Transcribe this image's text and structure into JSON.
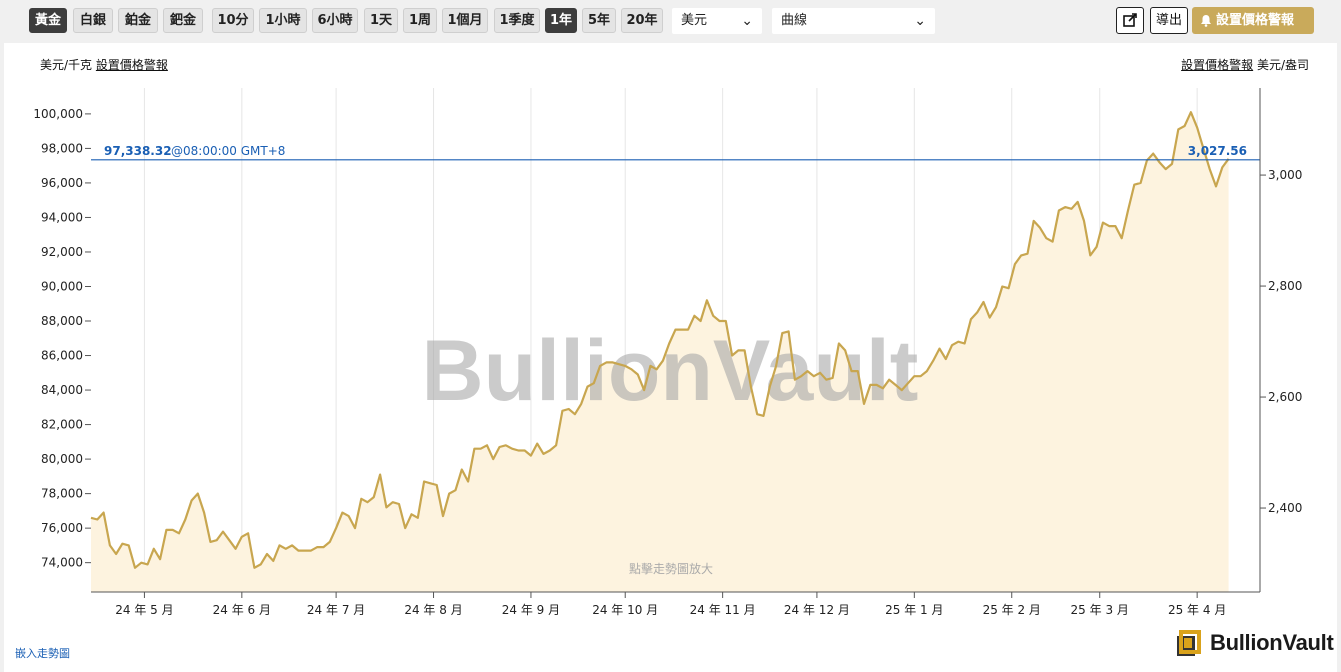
{
  "toolbar": {
    "metals": [
      {
        "label": "黃金",
        "active": true
      },
      {
        "label": "白銀",
        "active": false
      },
      {
        "label": "鉑金",
        "active": false
      },
      {
        "label": "鈀金",
        "active": false
      }
    ],
    "ranges": [
      {
        "label": "10分",
        "active": false
      },
      {
        "label": "1小時",
        "active": false
      },
      {
        "label": "6小時",
        "active": false
      },
      {
        "label": "1天",
        "active": false
      },
      {
        "label": "1周",
        "active": false
      },
      {
        "label": "1個月",
        "active": false
      },
      {
        "label": "1季度",
        "active": false
      },
      {
        "label": "1年",
        "active": true
      },
      {
        "label": "5年",
        "active": false
      },
      {
        "label": "20年",
        "active": false
      }
    ],
    "currency": "美元",
    "chart_style": "曲線",
    "export_label": "導出",
    "alert_label": "設置價格警報",
    "open_icon": "external-link-icon",
    "bell_icon": "bell-icon"
  },
  "unit_left": "美元/千克",
  "unit_right": "美元/盎司",
  "alert_link": "設置價格警報",
  "watermark": "BullionVault",
  "zoom_hint": "點擊走勢圖放大",
  "embed_link": "嵌入走勢圖",
  "logo_text": "BullionVault",
  "colors": {
    "line": "#c8a64f",
    "fill": "#fdf3df",
    "current_line": "#1a5fb4",
    "active_btn": "#3d3d3d",
    "alert_btn": "#c9aa5b"
  },
  "chart_data": {
    "type": "area",
    "title": "",
    "xlabel": "",
    "ylabel": "美元/千克",
    "ylabel_right": "美元/盎司",
    "grid": true,
    "ylim": [
      72300,
      101500
    ],
    "ylim_right": [
      2248.7,
      3156.9
    ],
    "y_ticks_left": [
      "74,000",
      "76,000",
      "78,000",
      "80,000",
      "82,000",
      "84,000",
      "86,000",
      "88,000",
      "90,000",
      "92,000",
      "94,000",
      "96,000",
      "98,000",
      "100,000"
    ],
    "y_ticks_right": [
      "2,400",
      "2,600",
      "2,800",
      "3,000"
    ],
    "x_ticks": [
      "24 年 5 月",
      "24 年 6 月",
      "24 年 7 月",
      "24 年 8 月",
      "24 年 9 月",
      "24 年 10 月",
      "24 年 11 月",
      "24 年 12 月",
      "25 年 1 月",
      "25 年 2 月",
      "25 年 3 月",
      "25 年 4 月"
    ],
    "x_tick_dates": [
      "2024-05-01",
      "2024-06-01",
      "2024-07-01",
      "2024-08-01",
      "2024-09-01",
      "2024-10-01",
      "2024-11-01",
      "2024-12-01",
      "2025-01-01",
      "2025-02-01",
      "2025-03-01",
      "2025-04-01"
    ],
    "x_range": [
      "2024-04-14",
      "2025-04-21"
    ],
    "current": {
      "value_kg": "97,338.32",
      "time": "@08:00:00 GMT+8",
      "value_oz": "3,027.56",
      "y": 97338.32
    },
    "series": [
      {
        "unit": "USD/kg",
        "points": [
          [
            "2024-04-14",
            76600
          ],
          [
            "2024-04-16",
            76500
          ],
          [
            "2024-04-18",
            76900
          ],
          [
            "2024-04-20",
            75000
          ],
          [
            "2024-04-22",
            74500
          ],
          [
            "2024-04-24",
            75100
          ],
          [
            "2024-04-26",
            75000
          ],
          [
            "2024-04-28",
            73700
          ],
          [
            "2024-04-30",
            74000
          ],
          [
            "2024-05-02",
            73900
          ],
          [
            "2024-05-04",
            74800
          ],
          [
            "2024-05-06",
            74200
          ],
          [
            "2024-05-08",
            75900
          ],
          [
            "2024-05-10",
            75900
          ],
          [
            "2024-05-12",
            75700
          ],
          [
            "2024-05-14",
            76500
          ],
          [
            "2024-05-16",
            77600
          ],
          [
            "2024-05-18",
            78000
          ],
          [
            "2024-05-20",
            76900
          ],
          [
            "2024-05-22",
            75200
          ],
          [
            "2024-05-24",
            75300
          ],
          [
            "2024-05-26",
            75800
          ],
          [
            "2024-05-28",
            75300
          ],
          [
            "2024-05-30",
            74800
          ],
          [
            "2024-06-01",
            75500
          ],
          [
            "2024-06-03",
            75700
          ],
          [
            "2024-06-05",
            73700
          ],
          [
            "2024-06-07",
            73900
          ],
          [
            "2024-06-09",
            74500
          ],
          [
            "2024-06-11",
            74100
          ],
          [
            "2024-06-13",
            75000
          ],
          [
            "2024-06-15",
            74800
          ],
          [
            "2024-06-17",
            75000
          ],
          [
            "2024-06-19",
            74700
          ],
          [
            "2024-06-21",
            74700
          ],
          [
            "2024-06-23",
            74700
          ],
          [
            "2024-06-25",
            74900
          ],
          [
            "2024-06-27",
            74900
          ],
          [
            "2024-06-29",
            75200
          ],
          [
            "2024-07-01",
            76000
          ],
          [
            "2024-07-03",
            76900
          ],
          [
            "2024-07-05",
            76700
          ],
          [
            "2024-07-07",
            76000
          ],
          [
            "2024-07-09",
            77700
          ],
          [
            "2024-07-11",
            77500
          ],
          [
            "2024-07-13",
            77800
          ],
          [
            "2024-07-15",
            79100
          ],
          [
            "2024-07-17",
            77200
          ],
          [
            "2024-07-19",
            77500
          ],
          [
            "2024-07-21",
            77400
          ],
          [
            "2024-07-23",
            76000
          ],
          [
            "2024-07-25",
            76800
          ],
          [
            "2024-07-27",
            76600
          ],
          [
            "2024-07-29",
            78700
          ],
          [
            "2024-07-31",
            78600
          ],
          [
            "2024-08-02",
            78500
          ],
          [
            "2024-08-04",
            76700
          ],
          [
            "2024-08-06",
            78000
          ],
          [
            "2024-08-08",
            78200
          ],
          [
            "2024-08-10",
            79400
          ],
          [
            "2024-08-12",
            78700
          ],
          [
            "2024-08-14",
            80600
          ],
          [
            "2024-08-16",
            80600
          ],
          [
            "2024-08-18",
            80800
          ],
          [
            "2024-08-20",
            80000
          ],
          [
            "2024-08-22",
            80700
          ],
          [
            "2024-08-24",
            80800
          ],
          [
            "2024-08-26",
            80600
          ],
          [
            "2024-08-28",
            80500
          ],
          [
            "2024-08-30",
            80500
          ],
          [
            "2024-09-01",
            80200
          ],
          [
            "2024-09-03",
            80900
          ],
          [
            "2024-09-05",
            80300
          ],
          [
            "2024-09-07",
            80500
          ],
          [
            "2024-09-09",
            80800
          ],
          [
            "2024-09-11",
            82800
          ],
          [
            "2024-09-13",
            82900
          ],
          [
            "2024-09-15",
            82600
          ],
          [
            "2024-09-17",
            83200
          ],
          [
            "2024-09-19",
            84200
          ],
          [
            "2024-09-21",
            84400
          ],
          [
            "2024-09-23",
            85400
          ],
          [
            "2024-09-25",
            85600
          ],
          [
            "2024-09-27",
            85600
          ],
          [
            "2024-09-29",
            85500
          ],
          [
            "2024-10-01",
            85400
          ],
          [
            "2024-10-03",
            85200
          ],
          [
            "2024-10-05",
            84900
          ],
          [
            "2024-10-07",
            84000
          ],
          [
            "2024-10-09",
            85400
          ],
          [
            "2024-10-11",
            85200
          ],
          [
            "2024-10-13",
            85700
          ],
          [
            "2024-10-15",
            86700
          ],
          [
            "2024-10-17",
            87500
          ],
          [
            "2024-10-19",
            87500
          ],
          [
            "2024-10-21",
            87500
          ],
          [
            "2024-10-23",
            88300
          ],
          [
            "2024-10-25",
            88000
          ],
          [
            "2024-10-27",
            89200
          ],
          [
            "2024-10-29",
            88300
          ],
          [
            "2024-10-31",
            88000
          ],
          [
            "2024-11-02",
            88000
          ],
          [
            "2024-11-04",
            86000
          ],
          [
            "2024-11-06",
            86300
          ],
          [
            "2024-11-08",
            86300
          ],
          [
            "2024-11-10",
            84200
          ],
          [
            "2024-11-12",
            82600
          ],
          [
            "2024-11-14",
            82500
          ],
          [
            "2024-11-16",
            84200
          ],
          [
            "2024-11-18",
            85400
          ],
          [
            "2024-11-20",
            87300
          ],
          [
            "2024-11-22",
            87400
          ],
          [
            "2024-11-24",
            84600
          ],
          [
            "2024-11-26",
            84800
          ],
          [
            "2024-11-28",
            85100
          ],
          [
            "2024-11-30",
            84800
          ],
          [
            "2024-12-02",
            85000
          ],
          [
            "2024-12-04",
            84600
          ],
          [
            "2024-12-06",
            84700
          ],
          [
            "2024-12-08",
            86700
          ],
          [
            "2024-12-10",
            86300
          ],
          [
            "2024-12-12",
            85100
          ],
          [
            "2024-12-14",
            85100
          ],
          [
            "2024-12-16",
            83200
          ],
          [
            "2024-12-18",
            84300
          ],
          [
            "2024-12-20",
            84300
          ],
          [
            "2024-12-22",
            84100
          ],
          [
            "2024-12-24",
            84600
          ],
          [
            "2024-12-26",
            84300
          ],
          [
            "2024-12-28",
            84000
          ],
          [
            "2024-12-30",
            84400
          ],
          [
            "2025-01-01",
            84800
          ],
          [
            "2025-01-03",
            84800
          ],
          [
            "2025-01-05",
            85100
          ],
          [
            "2025-01-07",
            85700
          ],
          [
            "2025-01-09",
            86400
          ],
          [
            "2025-01-11",
            85800
          ],
          [
            "2025-01-13",
            86600
          ],
          [
            "2025-01-15",
            86800
          ],
          [
            "2025-01-17",
            86700
          ],
          [
            "2025-01-19",
            88100
          ],
          [
            "2025-01-21",
            88500
          ],
          [
            "2025-01-23",
            89100
          ],
          [
            "2025-01-25",
            88200
          ],
          [
            "2025-01-27",
            88800
          ],
          [
            "2025-01-29",
            90000
          ],
          [
            "2025-01-31",
            89900
          ],
          [
            "2025-02-02",
            91300
          ],
          [
            "2025-02-04",
            91800
          ],
          [
            "2025-02-06",
            91900
          ],
          [
            "2025-02-08",
            93800
          ],
          [
            "2025-02-10",
            93400
          ],
          [
            "2025-02-12",
            92800
          ],
          [
            "2025-02-14",
            92600
          ],
          [
            "2025-02-16",
            94400
          ],
          [
            "2025-02-18",
            94600
          ],
          [
            "2025-02-20",
            94500
          ],
          [
            "2025-02-22",
            94900
          ],
          [
            "2025-02-24",
            93800
          ],
          [
            "2025-02-26",
            91800
          ],
          [
            "2025-02-28",
            92300
          ],
          [
            "2025-03-02",
            93700
          ],
          [
            "2025-03-04",
            93500
          ],
          [
            "2025-03-06",
            93500
          ],
          [
            "2025-03-08",
            92800
          ],
          [
            "2025-03-10",
            94400
          ],
          [
            "2025-03-12",
            95900
          ],
          [
            "2025-03-14",
            96000
          ],
          [
            "2025-03-16",
            97300
          ],
          [
            "2025-03-18",
            97700
          ],
          [
            "2025-03-20",
            97200
          ],
          [
            "2025-03-22",
            96800
          ],
          [
            "2025-03-24",
            97100
          ],
          [
            "2025-03-26",
            99100
          ],
          [
            "2025-03-28",
            99300
          ],
          [
            "2025-03-30",
            100100
          ],
          [
            "2025-04-01",
            99200
          ],
          [
            "2025-04-03",
            98000
          ],
          [
            "2025-04-05",
            96800
          ],
          [
            "2025-04-07",
            95800
          ],
          [
            "2025-04-09",
            96900
          ],
          [
            "2025-04-11",
            97400
          ]
        ]
      }
    ]
  }
}
